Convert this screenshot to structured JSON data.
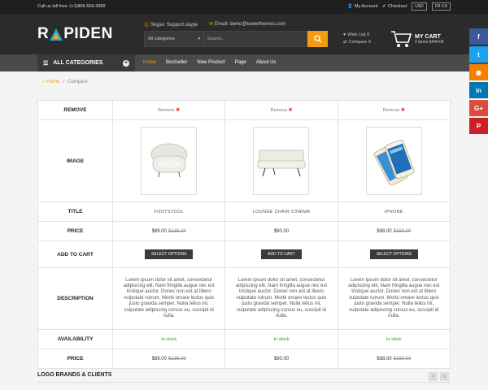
{
  "topbar": {
    "phone": "Call us toll free: (+1)866-550-3669",
    "my_account": "My Account",
    "checkout": "Checkout",
    "currency": "USD",
    "language": "FR-CA"
  },
  "header": {
    "logo_left": "R",
    "logo_right": "PIDEN",
    "skype": "Skype: Support.skype",
    "email": "Email: demo@towerthemes.com",
    "category_select": "All categories",
    "search_placeholder": "Search...",
    "wishlist": "Wish List 0",
    "compare": "Compare 0",
    "cart_title": "MY CART",
    "cart_summary": "2 items $444.00"
  },
  "nav": {
    "all_categories": "ALL CATEGORIES",
    "items": [
      "Home",
      "Bestseller",
      "New Product",
      "Page",
      "About Us"
    ]
  },
  "breadcrumb": {
    "home": "Home",
    "sep": "/",
    "current": "Compare"
  },
  "compare": {
    "labels": {
      "remove": "REMOVE",
      "image": "IMAGE",
      "title": "TITLE",
      "price": "PRICE",
      "add_to_cart": "ADD TO CART",
      "description": "DESCRIPTION",
      "availability": "AVAILABILITY",
      "price2": "PRICE"
    },
    "remove_text": "Remove",
    "button_text": "SELECT OPTIONS",
    "products": [
      {
        "title": "FOOTSTOOL",
        "price": "$89.00",
        "old_price": "$135.00",
        "button": "SELECT OPTIONS",
        "description": "Lorem ipsum dolor sit amet, consectetur adipiscing elit. Nam fringilla augue nec est tristique auctor. Donec non est at libero vulputate rutrum. Morbi ornare lectus quis justo gravida semper. Nulla tellus mi, vulputate adipiscing cursus eu, suscipit id nulla.",
        "availability": "In stock"
      },
      {
        "title": "LOUNGE CHAIR CINEMA",
        "price": "$90.00",
        "old_price": "",
        "button": "ADD TO CART",
        "description": "Lorem ipsum dolor sit amet, consectetur adipiscing elit. Nam fringilla augue nec est tristique auctor. Donec non est at libero vulputate rutrum. Morbi ornare lectus quis justo gravida semper. Nulla tellus mi, vulputate adipiscing cursus eu, suscipit id nulla.",
        "availability": "In stock"
      },
      {
        "title": "IPHONE",
        "price": "$98.00",
        "old_price": "$150.00",
        "button": "SELECT OPTIONS",
        "description": "Lorem ipsum dolor sit amet, consectetur adipiscing elit. Nam fringilla augue nec est tristique auctor. Donec non est at libero vulputate rutrum. Morbi ornare lectus quis justo gravida semper. Nulla tellus mi, vulputate adipiscing cursus eu, suscipit id nulla.",
        "availability": "In stock"
      }
    ]
  },
  "brands": {
    "title": "LOGO BRANDS & CLIENTS"
  },
  "social": [
    {
      "icon": "facebook-icon",
      "glyph": "f",
      "color": "#3b5998"
    },
    {
      "icon": "twitter-icon",
      "glyph": "t",
      "color": "#1da1f2"
    },
    {
      "icon": "rss-icon",
      "glyph": "◉",
      "color": "#f57d00"
    },
    {
      "icon": "linkedin-icon",
      "glyph": "in",
      "color": "#0077b5"
    },
    {
      "icon": "googleplus-icon",
      "glyph": "G+",
      "color": "#dd4b39"
    },
    {
      "icon": "pinterest-icon",
      "glyph": "P",
      "color": "#cb2027"
    }
  ],
  "colors": {
    "accent": "#f39c12",
    "dark": "#2b2b2b",
    "stock": "#2b9a2b"
  }
}
